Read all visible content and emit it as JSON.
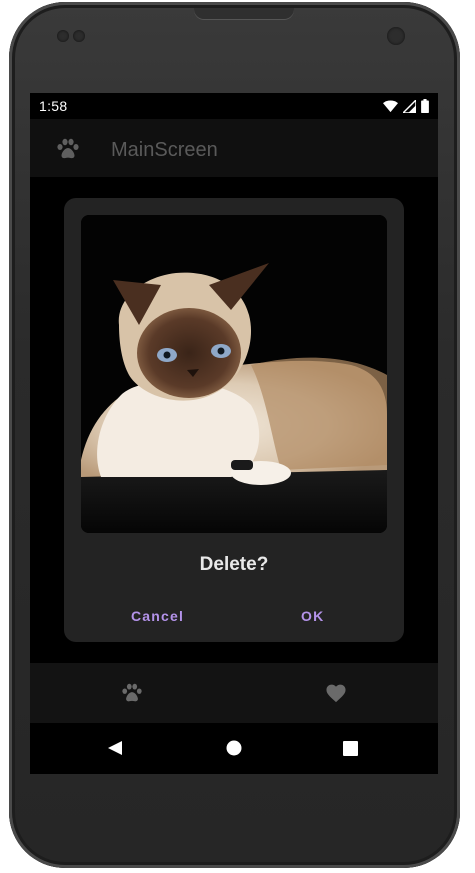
{
  "status_bar": {
    "time": "1:58",
    "icons": [
      "wifi-icon",
      "signal-icon",
      "battery-icon"
    ]
  },
  "app_bar": {
    "icon": "paw-icon",
    "title": "MainScreen"
  },
  "dialog": {
    "image": "cat-photo",
    "title": "Delete?",
    "cancel_label": "Cancel",
    "ok_label": "OK"
  },
  "bottom_nav": {
    "items": [
      {
        "icon": "paw-icon"
      },
      {
        "icon": "heart-icon"
      }
    ]
  },
  "system_nav": {
    "items": [
      "back-icon",
      "home-icon",
      "recents-icon"
    ]
  },
  "colors": {
    "accent": "#b493ea",
    "dialog_bg": "#232323",
    "app_bar_bg": "#101010",
    "screen_bg": "#000000"
  }
}
